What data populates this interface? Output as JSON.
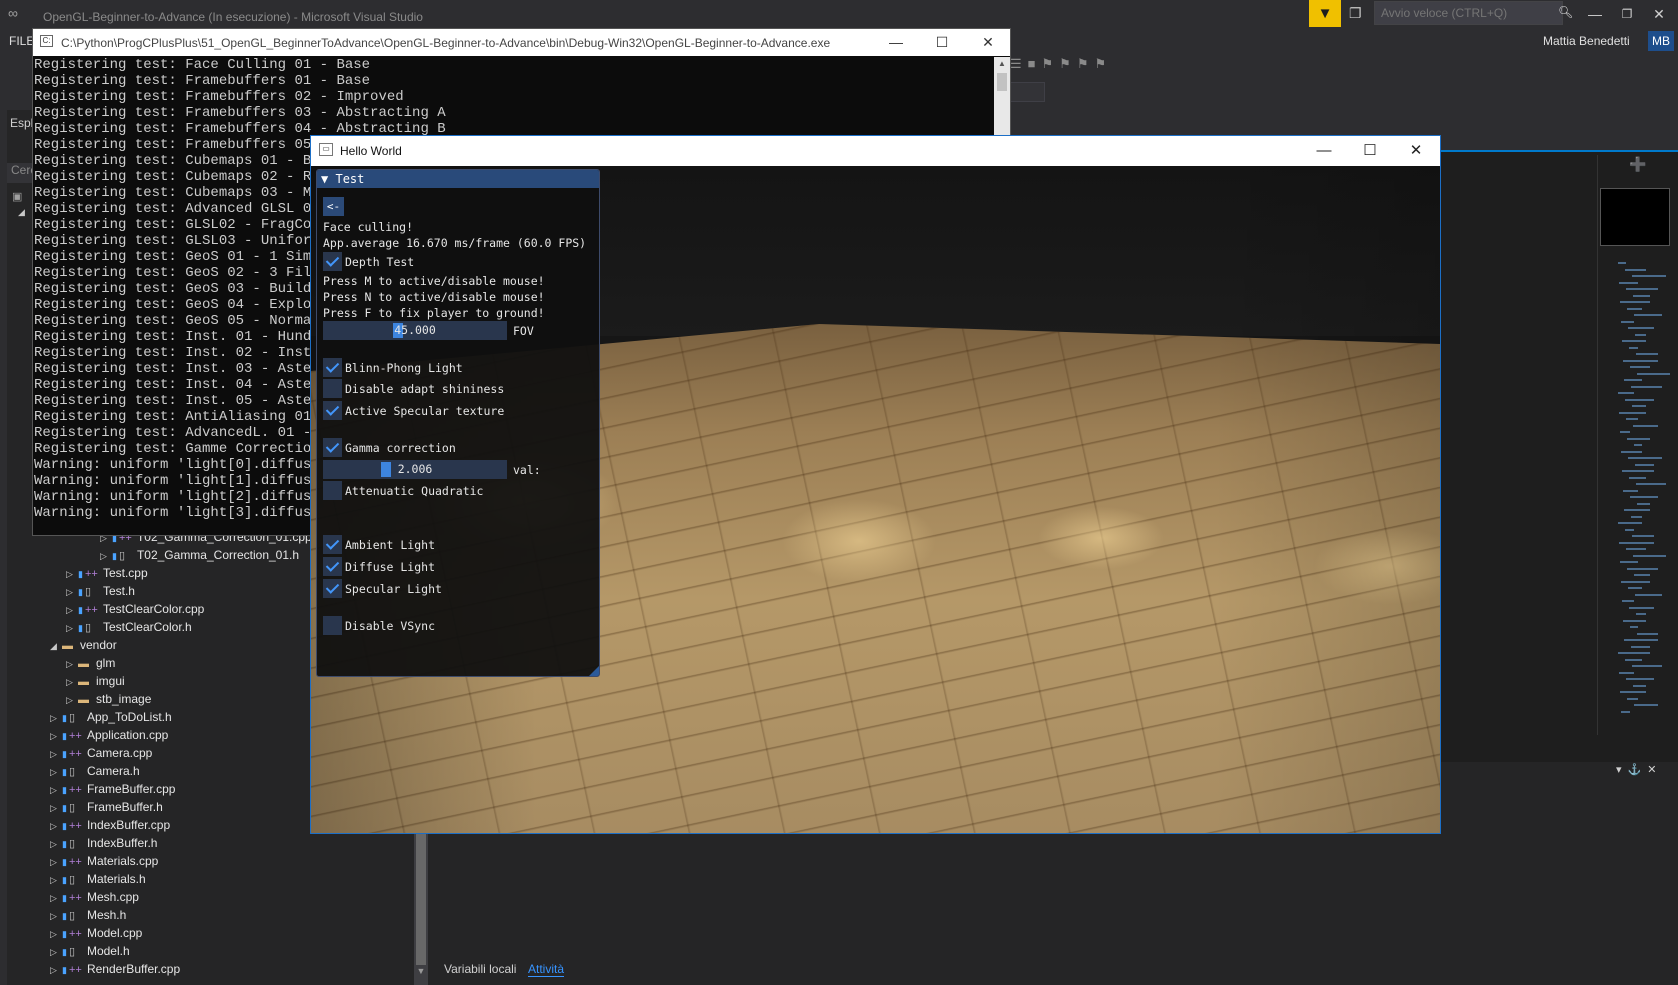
{
  "vs": {
    "title": "OpenGL-Beginner-to-Advance (In esecuzione) - Microsoft Visual Studio",
    "quick_launch_placeholder": "Avvio veloce (CTRL+Q)",
    "user_name": "Mattia Benedetti",
    "user_initials": "MB",
    "menu_file": "FILE"
  },
  "solution_explorer": {
    "tab_label": "Espl",
    "search_placeholder": "Cerc",
    "items": [
      {
        "label": "T02_Gamma_Correction_01.cpp",
        "kind": "cpp"
      },
      {
        "label": "T02_Gamma_Correction_01.h",
        "kind": "h"
      },
      {
        "label": "Test.cpp",
        "kind": "cpp"
      },
      {
        "label": "Test.h",
        "kind": "h"
      },
      {
        "label": "TestClearColor.cpp",
        "kind": "cpp"
      },
      {
        "label": "TestClearColor.h",
        "kind": "h"
      },
      {
        "label": "vendor",
        "kind": "folder"
      },
      {
        "label": "glm",
        "kind": "folder"
      },
      {
        "label": "imgui",
        "kind": "folder"
      },
      {
        "label": "stb_image",
        "kind": "folder"
      },
      {
        "label": "App_ToDoList.h",
        "kind": "h"
      },
      {
        "label": "Application.cpp",
        "kind": "cpp"
      },
      {
        "label": "Camera.cpp",
        "kind": "cpp"
      },
      {
        "label": "Camera.h",
        "kind": "h"
      },
      {
        "label": "FrameBuffer.cpp",
        "kind": "cpp"
      },
      {
        "label": "FrameBuffer.h",
        "kind": "h"
      },
      {
        "label": "IndexBuffer.cpp",
        "kind": "cpp"
      },
      {
        "label": "IndexBuffer.h",
        "kind": "h"
      },
      {
        "label": "Materials.cpp",
        "kind": "cpp"
      },
      {
        "label": "Materials.h",
        "kind": "h"
      },
      {
        "label": "Mesh.cpp",
        "kind": "cpp"
      },
      {
        "label": "Mesh.h",
        "kind": "h"
      },
      {
        "label": "Model.cpp",
        "kind": "cpp"
      },
      {
        "label": "Model.h",
        "kind": "h"
      },
      {
        "label": "RenderBuffer.cpp",
        "kind": "cpp"
      }
    ]
  },
  "bottom_panel": {
    "tab_locals": "Variabili locali",
    "tab_activity": "Attività"
  },
  "console": {
    "title": "C:\\Python\\ProgCPlusPlus\\51_OpenGL_BeginnerToAdvance\\OpenGL-Beginner-to-Advance\\bin\\Debug-Win32\\OpenGL-Beginner-to-Advance.exe",
    "lines": [
      "Registering test: Face Culling 01 - Base",
      "Registering test: Framebuffers 01 - Base",
      "Registering test: Framebuffers 02 - Improved",
      "Registering test: Framebuffers 03 - Abstracting A",
      "Registering test: Framebuffers 04 - Abstracting B",
      "Registering test: Framebuffers 05",
      "Registering test: Cubemaps 01 - Bas",
      "Registering test: Cubemaps 02 - Ref",
      "Registering test: Cubemaps 03 - Mod",
      "Registering test: Advanced GLSL 01",
      "Registering test: GLSL02 - FragCoor",
      "Registering test: GLSL03 - Uniform",
      "Registering test: GeoS 01 - 1 Simpl",
      "Registering test: GeoS 02 - 3 Files",
      "Registering test: GeoS 03 - Build a",
      "Registering test: GeoS 04 - Explodi",
      "Registering test: GeoS 05 - Normal",
      "Registering test: Inst. 01 - Hundre",
      "Registering test: Inst. 02 - Instan",
      "Registering test: Inst. 03 - Astero",
      "Registering test: Inst. 04 - Astero",
      "Registering test: Inst. 05 - Astero",
      "Registering test: AntiAliasing 01 -",
      "Registering test: AdvancedL. 01 - B",
      "Registering test: Gamme Correction",
      "Warning: uniform 'light[0].diffuse",
      "Warning: uniform 'light[1].diffuse",
      "Warning: uniform 'light[2].diffuse",
      "Warning: uniform 'light[3].diffuse"
    ]
  },
  "hello_world": {
    "title": "Hello World"
  },
  "imgui": {
    "header": "Test",
    "back_label": "<-",
    "face_culling": "Face culling!",
    "app_average": "App.average 16.670 ms/frame (60.0 FPS)",
    "depth_test": {
      "label": "Depth Test",
      "checked": true
    },
    "press_m": "Press M to active/disable mouse!",
    "press_n": "Press N to active/disable mouse!",
    "press_f": "Press F to fix player to ground!",
    "fov": {
      "value": "45.000",
      "label": "FOV",
      "fraction": 0.4
    },
    "blinn": {
      "label": "Blinn-Phong Light",
      "checked": true
    },
    "disable_adapt": {
      "label": "Disable adapt shininess",
      "checked": false
    },
    "active_spec": {
      "label": "Active Specular texture",
      "checked": true
    },
    "gamma": {
      "label": "Gamma correction",
      "checked": true
    },
    "gamma_val": {
      "value": "2.006",
      "label": "val:",
      "fraction": 0.33
    },
    "atten": {
      "label": "Attenuatic Quadratic",
      "checked": false
    },
    "ambient": {
      "label": "Ambient Light",
      "checked": true
    },
    "diffuse": {
      "label": "Diffuse Light",
      "checked": true
    },
    "specular": {
      "label": "Specular Light",
      "checked": true
    },
    "vsync": {
      "label": "Disable VSync",
      "checked": false
    }
  },
  "colors": {
    "vs_accent": "#007acc",
    "filter_yellow": "#f0c000",
    "imgui_header": "#294a7a",
    "imgui_check": "#4296fa"
  }
}
